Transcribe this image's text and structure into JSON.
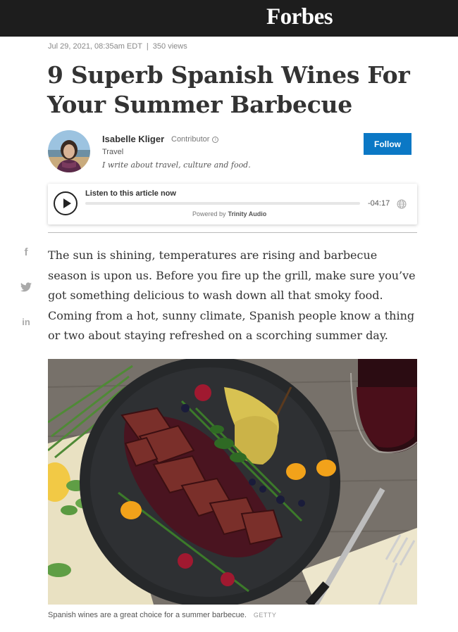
{
  "header": {
    "logo": "Forbes"
  },
  "article": {
    "date": "Jul 29, 2021, 08:35am EDT",
    "separator": "|",
    "views": "350 views",
    "title": "9 Superb Spanish Wines For Your Summer Barbecue",
    "body": "The sun is shining, temperatures are rising and barbecue season is upon us. Before you fire up the grill, make sure you’ve got something delicious to wash down all that smoky food. Coming from a hot, sunny climate, Spanish people know a thing or two about staying refreshed on a scorching summer day."
  },
  "author": {
    "name": "Isabelle Kliger",
    "role": "Contributor",
    "section": "Travel",
    "bio": "I write about travel, culture and food.",
    "follow_label": "Follow"
  },
  "audio_player": {
    "label": "Listen to this article now",
    "time_remaining": "-04:17",
    "progress": 0,
    "powered_by": "Powered by",
    "provider": "Trinity Audio",
    "icons": {
      "play": "play-icon",
      "language": "globe-icon"
    }
  },
  "share": {
    "icons": [
      "facebook-icon",
      "twitter-icon",
      "linkedin-icon"
    ]
  },
  "image": {
    "caption": "Spanish wines are a great choice for a summer barbecue.",
    "credit": "GETTY"
  },
  "colors": {
    "header_bg": "#1d1d1d",
    "follow_button": "#0b78c5",
    "text": "#333333"
  }
}
